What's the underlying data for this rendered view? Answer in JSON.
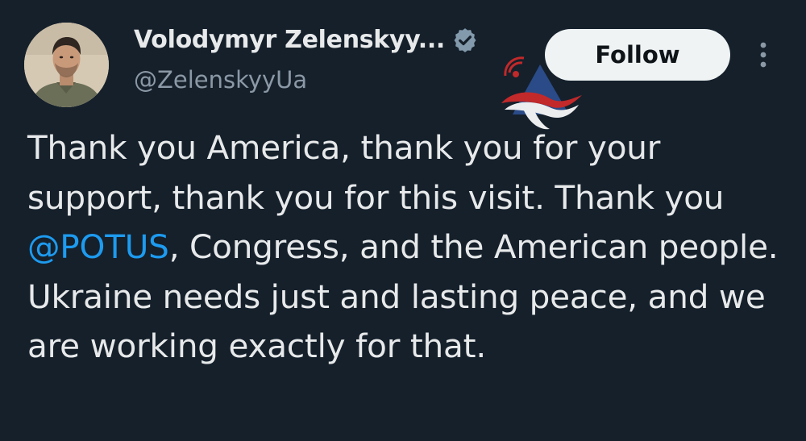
{
  "tweet": {
    "author": {
      "display_name": "Volodymyr Zelenskyy...",
      "handle": "@ZelenskyyUa",
      "verified_icon": "verified-badge-icon",
      "avatar_icon": "profile-photo"
    },
    "follow_label": "Follow",
    "more_icon": "more-vertical-icon",
    "paragraphs": [
      {
        "before": "Thank you America, thank you for your support, thank you for this visit. Thank you ",
        "mention": "@POTUS",
        "after": ", Congress, and the American people."
      },
      {
        "text": "Ukraine needs just and lasting peace, and we are working exactly for that."
      }
    ]
  },
  "colors": {
    "background": "#15202b",
    "text": "#e7e9ea",
    "secondary_text": "#8b98a5",
    "mention": "#1d9bf0",
    "follow_button_bg": "#eff3f4",
    "verified_badge": "#829aab"
  }
}
